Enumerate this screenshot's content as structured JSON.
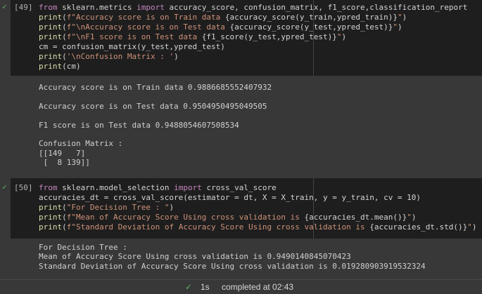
{
  "cells": [
    {
      "number": "[49]",
      "code": [
        [
          [
            "kw",
            "from"
          ],
          [
            "tx",
            " sklearn.metrics "
          ],
          [
            "kw",
            "import"
          ],
          [
            "tx",
            " accuracy_score, confusion_matrix, f1_score,classification_report"
          ]
        ],
        [
          [
            "fn",
            "print"
          ],
          [
            "tx",
            "("
          ],
          [
            "st",
            "f\"Accuracy score is on Train data "
          ],
          [
            "tx",
            "{accuracy_score(y_train,ypred_train)}"
          ],
          [
            "st",
            "\""
          ],
          [
            "tx",
            ")"
          ]
        ],
        [
          [
            "fn",
            "print"
          ],
          [
            "tx",
            "("
          ],
          [
            "st",
            "f\"\\nAccuracy score is on Test data "
          ],
          [
            "tx",
            "{accuracy_score(y_test,ypred_test)}"
          ],
          [
            "st",
            "\""
          ],
          [
            "tx",
            ")"
          ]
        ],
        [
          [
            "fn",
            "print"
          ],
          [
            "tx",
            "("
          ],
          [
            "st",
            "f\"\\nF1 score is on Test data "
          ],
          [
            "tx",
            "{f1_score(y_test,ypred_test)}"
          ],
          [
            "st",
            "\""
          ],
          [
            "tx",
            ")"
          ]
        ],
        [
          [
            "tx",
            "cm = confusion_matrix(y_test,ypred_test)"
          ]
        ],
        [
          [
            "fn",
            "print"
          ],
          [
            "tx",
            "("
          ],
          [
            "st",
            "'\\nConfusion Matrix : '"
          ],
          [
            "tx",
            ")"
          ]
        ],
        [
          [
            "fn",
            "print"
          ],
          [
            "tx",
            "(cm)"
          ]
        ]
      ],
      "output": "Accuracy score is on Train data 0.9886685552407932\n\nAccuracy score is on Test data 0.9504950495049505\n\nF1 score is on Test data 0.9488054607508534\n\nConfusion Matrix :\n[[149   7]\n [  8 139]]"
    },
    {
      "number": "[50]",
      "code": [
        [
          [
            "kw",
            "from"
          ],
          [
            "tx",
            " sklearn.model_selection "
          ],
          [
            "kw",
            "import"
          ],
          [
            "tx",
            " cross_val_score"
          ]
        ],
        [
          [
            "tx",
            "accuracies_dt = cross_val_score(estimator = dt, X = X_train, y = y_train, cv = 10)"
          ]
        ],
        [
          [
            "fn",
            "print"
          ],
          [
            "tx",
            "("
          ],
          [
            "st",
            "\"For Decision Tree : \""
          ],
          [
            "tx",
            ")"
          ]
        ],
        [
          [
            "fn",
            "print"
          ],
          [
            "tx",
            "("
          ],
          [
            "st",
            "f\"Mean of Accuracy Score Using cross validation is "
          ],
          [
            "tx",
            "{accuracies_dt.mean()}"
          ],
          [
            "st",
            "\""
          ],
          [
            "tx",
            ")"
          ]
        ],
        [
          [
            "fn",
            "print"
          ],
          [
            "tx",
            "("
          ],
          [
            "st",
            "f\"Standard Deviation of Accuracy Score Using cross validation is "
          ],
          [
            "tx",
            "{accuracies_dt.std()}"
          ],
          [
            "st",
            "\""
          ],
          [
            "tx",
            ")"
          ]
        ]
      ],
      "output": "For Decision Tree :\nMean of Accuracy Score Using cross validation is 0.9490140845070423\nStandard Deviation of Accuracy Score Using cross validation is 0.019280903919532324"
    }
  ],
  "status": {
    "check": "✓",
    "duration": "1s",
    "text": "completed at 02:43"
  }
}
